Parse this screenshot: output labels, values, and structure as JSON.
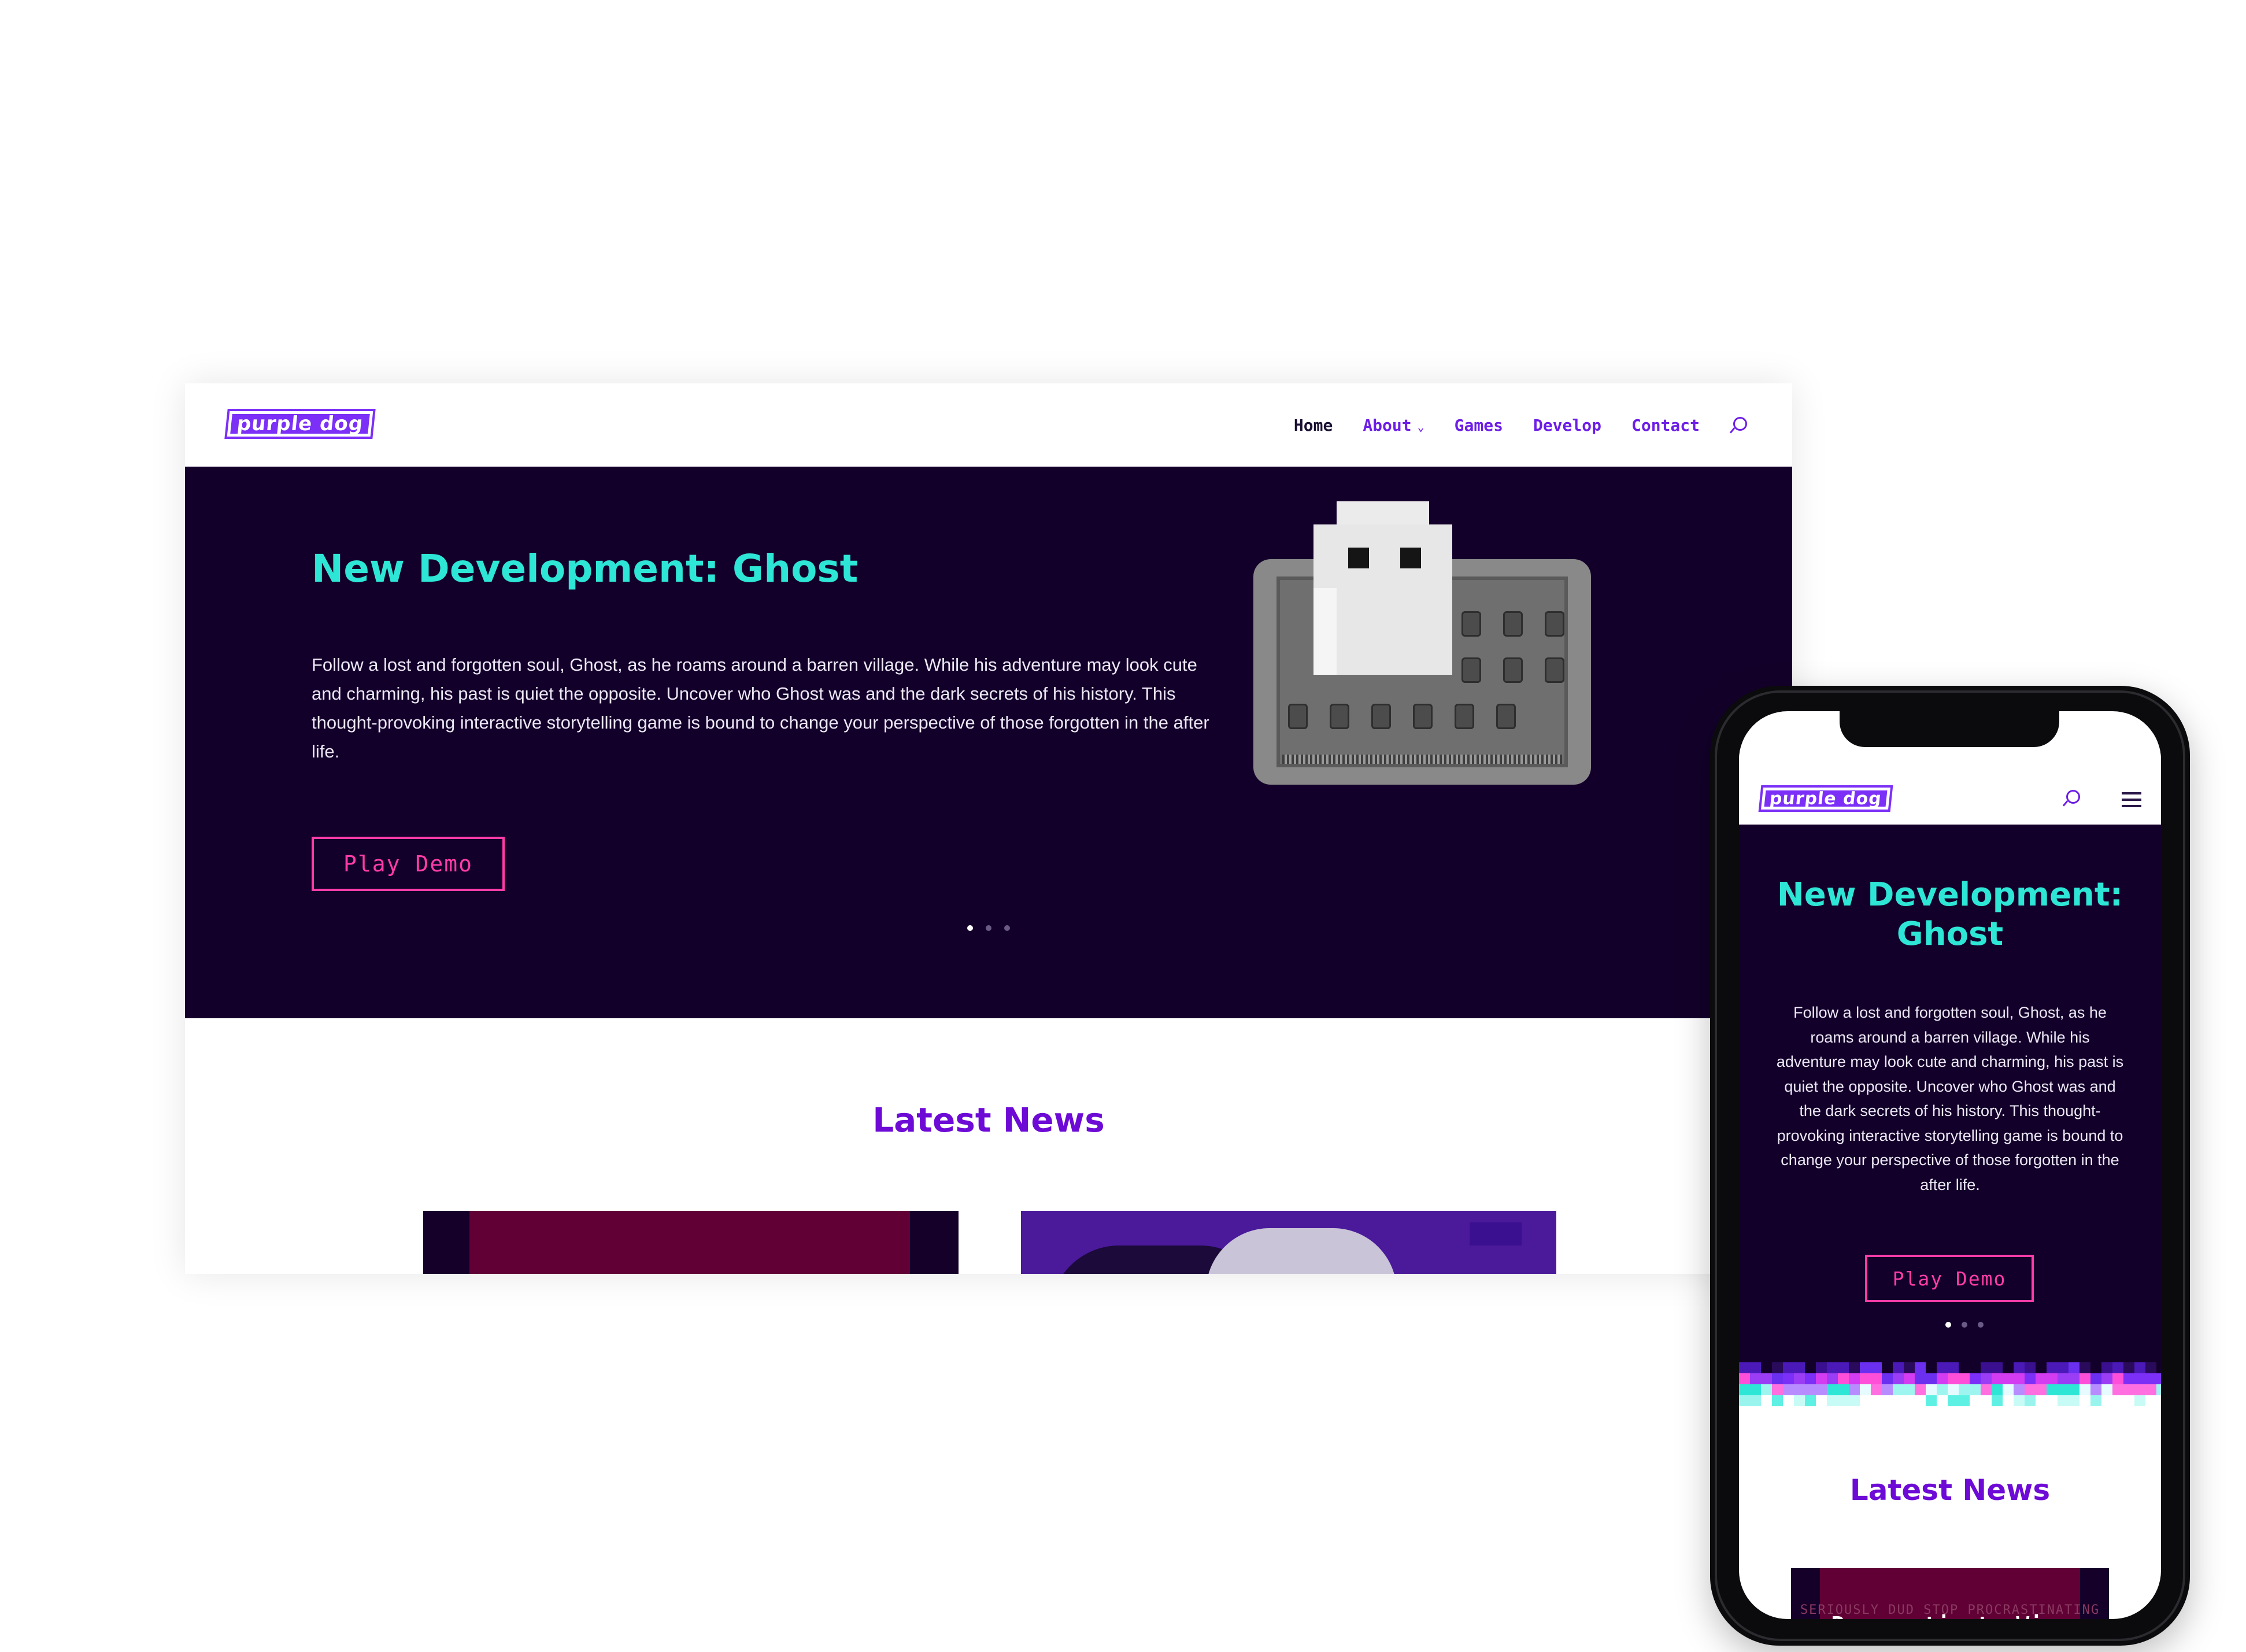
{
  "brand": {
    "logo_text": "purple dog"
  },
  "desktop": {
    "nav": [
      {
        "label": "Home",
        "active": true
      },
      {
        "label": "About",
        "has_dropdown": true
      },
      {
        "label": "Games"
      },
      {
        "label": "Develop"
      },
      {
        "label": "Contact"
      }
    ],
    "hero": {
      "title": "New Development: Ghost",
      "body": "Follow a lost and forgotten soul, Ghost, as he roams around a barren village. While his adventure may look cute and charming, his past is quiet the opposite. Uncover who Ghost was and the dark secrets of his history. This thought-provoking interactive storytelling game is bound to change your perspective of those forgotten in the after life.",
      "cta": "Play Demo",
      "slides": 3,
      "active_slide": 1
    },
    "news": {
      "title": "Latest News"
    }
  },
  "mobile": {
    "hero": {
      "title": "New Development: Ghost",
      "body": "Follow a lost and forgotten soul, Ghost, as he roams around a barren village. While his adventure may look cute and charming, his past is quiet the opposite. Uncover who Ghost was and the dark secrets of his history. This thought-provoking interactive storytelling game is bound to change your perspective of those forgotten in the after life.",
      "cta": "Play Demo",
      "slides": 3,
      "active_slide": 1
    },
    "news": {
      "title": "Latest News",
      "first_post_title": "Procrastinate Wins",
      "first_post_image_text": "SERIOUSLY DUD STOP PROCRASTINATING"
    }
  },
  "icons": {
    "search": "search-icon",
    "menu": "hamburger-menu-icon",
    "dropdown": "chevron-down-icon"
  },
  "colors": {
    "brand_purple": "#6d0ad6",
    "hero_bg": "#13002a",
    "hero_title": "#2ee6d6",
    "cta_pink": "#ff3ca8",
    "strip": [
      "#7b2ff7",
      "#ff3ca8",
      "#2ee6d6"
    ]
  }
}
